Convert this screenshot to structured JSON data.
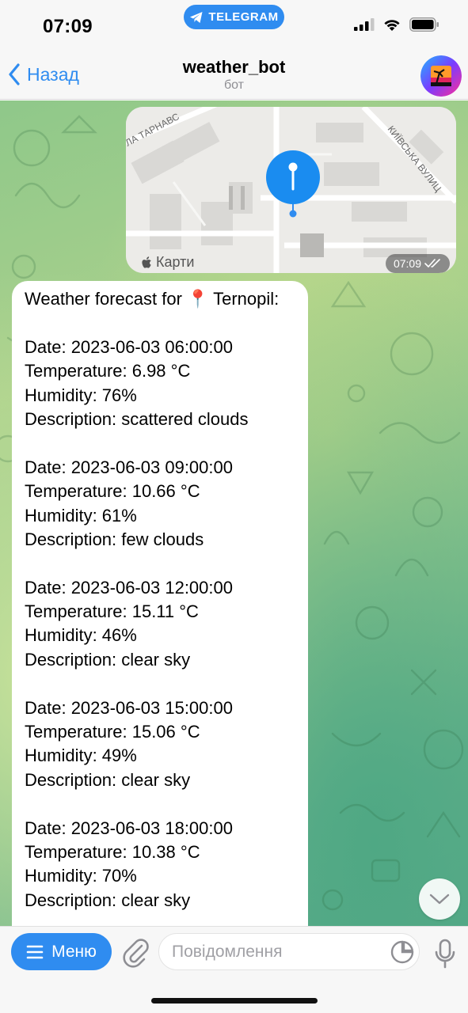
{
  "status_bar": {
    "time": "07:09",
    "telegram_pill": "TELEGRAM",
    "icons": [
      "cellular-signal-icon",
      "wifi-icon",
      "battery-icon"
    ]
  },
  "nav": {
    "back_label": "Назад",
    "title": "weather_bot",
    "subtitle": "бот"
  },
  "map": {
    "street_labels": [
      "ЛА ТАРНАВС",
      "КИЇВСЬКА ВУЛИЦ"
    ],
    "brand": "Карти",
    "time": "07:09"
  },
  "message": {
    "header": "Weather forecast for 📍 Ternopil:",
    "forecasts": [
      {
        "date": "Date: 2023-06-03 06:00:00",
        "temperature": "Temperature: 6.98 °C",
        "humidity": "Humidity: 76%",
        "description": "Description: scattered clouds"
      },
      {
        "date": "Date: 2023-06-03 09:00:00",
        "temperature": "Temperature: 10.66 °C",
        "humidity": "Humidity: 61%",
        "description": "Description: few clouds"
      },
      {
        "date": "Date: 2023-06-03 12:00:00",
        "temperature": "Temperature: 15.11 °C",
        "humidity": "Humidity: 46%",
        "description": "Description: clear sky"
      },
      {
        "date": "Date: 2023-06-03 15:00:00",
        "temperature": "Temperature: 15.06 °C",
        "humidity": "Humidity: 49%",
        "description": "Description: clear sky"
      },
      {
        "date": "Date: 2023-06-03 18:00:00",
        "temperature": "Temperature: 10.38 °C",
        "humidity": "Humidity: 70%",
        "description": "Description: clear sky"
      }
    ]
  },
  "composer": {
    "menu_label": "Меню",
    "placeholder": "Повідомлення"
  },
  "colors": {
    "accent": "#2f8cf0",
    "bubble": "#ffffff",
    "chat_green": "#8fc88a"
  }
}
